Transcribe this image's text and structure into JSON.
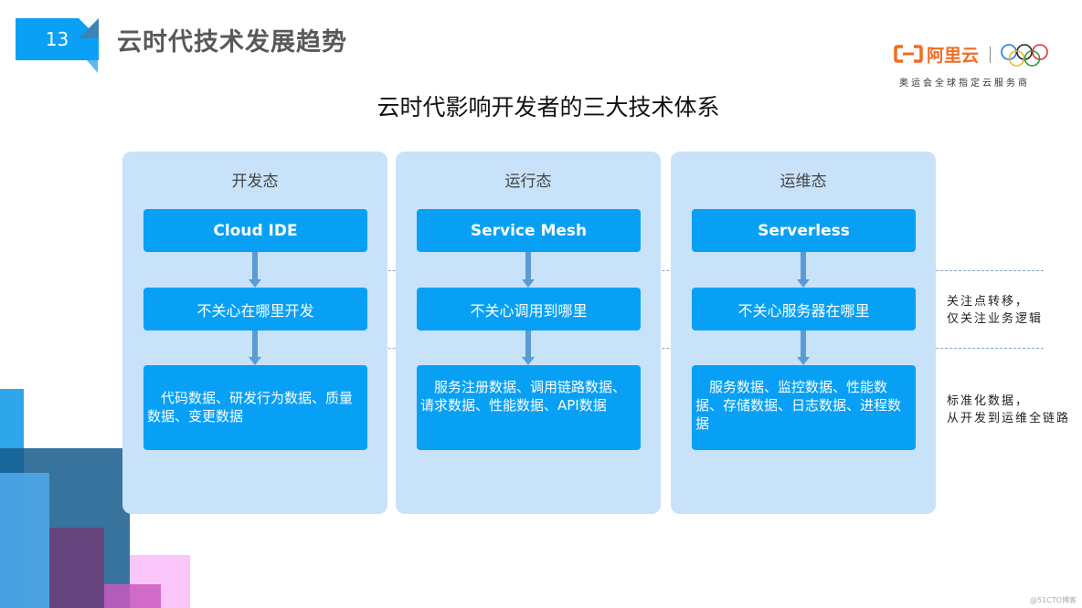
{
  "slide": {
    "number": "13",
    "title": "云时代技术发展趋势"
  },
  "logo": {
    "brand": "阿里云",
    "subtitle": "奥运会全球指定云服务商",
    "brand_color": "#f36c21"
  },
  "heading": "云时代影响开发者的三大技术体系",
  "columns": [
    {
      "title": "开发态",
      "technology": "Cloud IDE",
      "concern": "不关心在哪里开发",
      "data": "代码数据、研发行为数据、质量数据、变更数据"
    },
    {
      "title": "运行态",
      "technology": "Service Mesh",
      "concern": "不关心调用到哪里",
      "data": "服务注册数据、调用链路数据、请求数据、性能数据、API数据"
    },
    {
      "title": "运维态",
      "technology": "Serverless",
      "concern": "不关心服务器在哪里",
      "data": "服务数据、监控数据、性能数据、存储数据、日志数据、进程数据"
    }
  ],
  "notes": {
    "concern_note_line1": "关注点转移，",
    "concern_note_line2": "仅关注业务逻辑",
    "data_note_line1": "标准化数据，",
    "data_note_line2": "从开发到运维全链路"
  },
  "colors": {
    "accent": "#08a0f5",
    "panel_bg": "#c8e2fa",
    "arrow": "#5b9bd5"
  },
  "watermark": "@51CTO博客"
}
